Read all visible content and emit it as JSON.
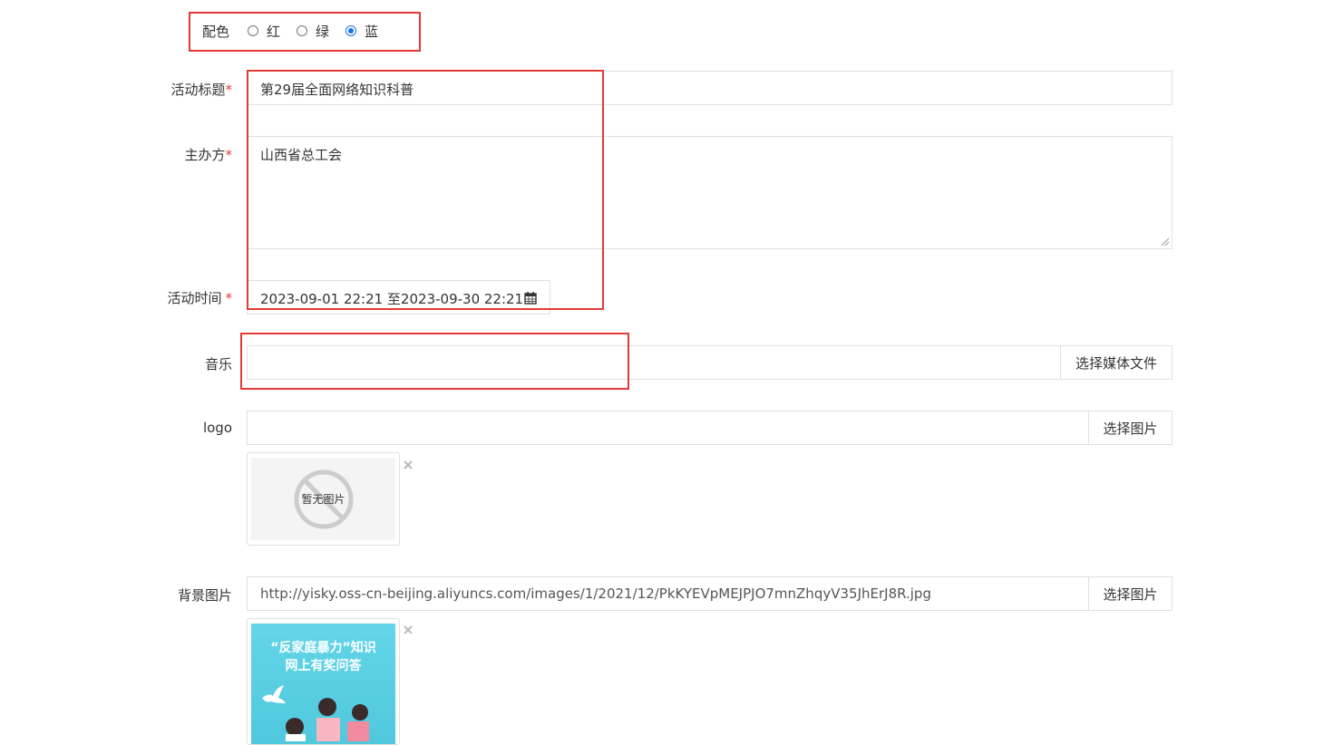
{
  "color_scheme": {
    "label": "配色",
    "options": [
      {
        "label": "红",
        "selected": false
      },
      {
        "label": "绿",
        "selected": false
      },
      {
        "label": "蓝",
        "selected": true
      }
    ]
  },
  "title_field": {
    "label": "活动标题",
    "required_mark": "*",
    "value": "第29届全面网络知识科普"
  },
  "organizer_field": {
    "label": "主办方",
    "required_mark": "*",
    "value": "山西省总工会"
  },
  "time_field": {
    "label": "活动时间",
    "required_mark": "*",
    "value": "2023-09-01 22:21 至2023-09-30 22:21",
    "icon": "calendar-icon"
  },
  "music_field": {
    "label": "音乐",
    "value": "",
    "button_label": "选择媒体文件"
  },
  "logo_field": {
    "label": "logo",
    "value": "",
    "button_label": "选择图片",
    "placeholder_text": "暂无图片",
    "remove_icon": "close-icon"
  },
  "background_field": {
    "label": "背景图片",
    "value": "http://yisky.oss-cn-beijing.aliyuncs.com/images/1/2021/12/PkKYEVpMEJPJO7mnZhqyV35JhErJ8R.jpg",
    "button_label": "选择图片",
    "preview_text_line1": "“反家庭暴力”知识",
    "preview_text_line2": "网上有奖问答",
    "remove_icon": "close-icon"
  },
  "colors": {
    "required": "#e53935",
    "highlight_box": "#e53935",
    "radio_selected": "#1a73e8",
    "preview_bg": "#5fd3e6"
  }
}
